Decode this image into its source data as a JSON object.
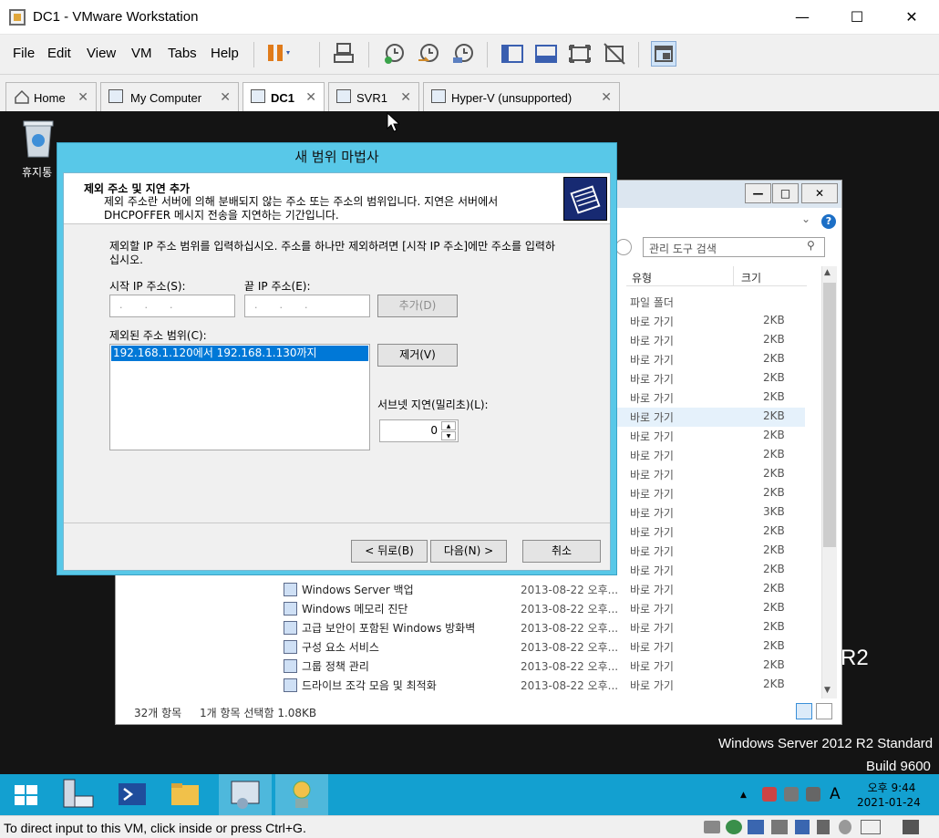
{
  "window": {
    "title": "DC1 - VMware Workstation",
    "minimize": "—",
    "maximize": "☐",
    "close": "✕"
  },
  "menubar": [
    {
      "key": "F",
      "rest": "ile"
    },
    {
      "key": "E",
      "rest": "dit"
    },
    {
      "key": "V",
      "rest": "iew"
    },
    {
      "key": "V",
      "rest": "M",
      "prefix": ""
    },
    {
      "key": "T",
      "rest": "abs"
    },
    {
      "key": "H",
      "rest": "elp"
    }
  ],
  "menu_labels": [
    "File",
    "Edit",
    "View",
    "VM",
    "Tabs",
    "Help"
  ],
  "tabs": [
    {
      "label": "Home",
      "close": "✕"
    },
    {
      "label": "My Computer",
      "close": "✕"
    },
    {
      "label": "DC1",
      "close": "✕"
    },
    {
      "label": "SVR1",
      "close": "✕"
    },
    {
      "label": "Hyper-V (unsupported)",
      "close": "✕"
    }
  ],
  "desktop": {
    "recycle_bin": "휴지통",
    "os_line1": "Windows Server 2012 R2 Standard",
    "os_line2": "Build 9600",
    "r2": "R2"
  },
  "explorer": {
    "search_placeholder": "관리 도구 검색",
    "help": "?",
    "col_type": "유형",
    "col_size": "크기",
    "upper_rows": [
      {
        "type": "파일 폴더",
        "size": ""
      },
      {
        "type": "바로 가기",
        "size": "2KB"
      },
      {
        "type": "바로 가기",
        "size": "2KB"
      },
      {
        "type": "바로 가기",
        "size": "2KB"
      },
      {
        "type": "바로 가기",
        "size": "2KB"
      },
      {
        "type": "바로 가기",
        "size": "2KB"
      },
      {
        "type": "바로 가기",
        "size": "2KB"
      },
      {
        "type": "바로 가기",
        "size": "2KB"
      },
      {
        "type": "바로 가기",
        "size": "2KB"
      },
      {
        "type": "바로 가기",
        "size": "2KB"
      },
      {
        "type": "바로 가기",
        "size": "2KB"
      },
      {
        "type": "바로 가기",
        "size": "3KB"
      },
      {
        "type": "바로 가기",
        "size": "2KB"
      },
      {
        "type": "바로 가기",
        "size": "2KB"
      },
      {
        "type": "바로 가기",
        "size": "2KB"
      }
    ],
    "rows": [
      {
        "name": "Windows Server 백업",
        "date": "2013-08-22 오후...",
        "type": "바로 가기",
        "size": "2KB"
      },
      {
        "name": "Windows 메모리 진단",
        "date": "2013-08-22 오후...",
        "type": "바로 가기",
        "size": "2KB"
      },
      {
        "name": "고급 보안이 포함된 Windows 방화벽",
        "date": "2013-08-22 오후...",
        "type": "바로 가기",
        "size": "2KB"
      },
      {
        "name": "구성 요소 서비스",
        "date": "2013-08-22 오후...",
        "type": "바로 가기",
        "size": "2KB"
      },
      {
        "name": "그룹 정책 관리",
        "date": "2013-08-22 오후...",
        "type": "바로 가기",
        "size": "2KB"
      },
      {
        "name": "드라이브 조각 모음 및 최적화",
        "date": "2013-08-22 오후...",
        "type": "바로 가기",
        "size": "2KB"
      }
    ],
    "status_count": "32개 항목",
    "status_sel": "1개 항목 선택함 1.08KB"
  },
  "wizard": {
    "title": "새 범위 마법사",
    "heading": "제외 주소 및 지연 추가",
    "desc": "제외 주소란 서버에 의해 분배되지 않는 주소 또는 주소의 범위입니다. 지연은 서버에서 DHCPOFFER 메시지 전송을 지연하는 기간입니다.",
    "instr": "제외할 IP 주소 범위를 입력하십시오. 주소를 하나만 제외하려면 [시작 IP 주소]에만 주소를 입력하십시오.",
    "start_ip_label": "시작 IP 주소(S):",
    "end_ip_label": "끝 IP 주소(E):",
    "ip_dots": "...",
    "add_btn": "추가(D)",
    "excluded_label": "제외된 주소 범위(C):",
    "excluded_item": "192.168.1.120에서 192.168.1.130까지",
    "remove_btn": "제거(V)",
    "delay_label": "서브넷 지연(밀리초)(L):",
    "delay_value": "0",
    "back_btn": "< 뒤로(B)",
    "next_btn": "다음(N) >",
    "cancel_btn": "취소"
  },
  "taskbar": {
    "clock_time": "오후 9:44",
    "clock_date": "2021-01-24",
    "ime": "A"
  },
  "host_status": "To direct input to this VM, click inside or press Ctrl+G."
}
